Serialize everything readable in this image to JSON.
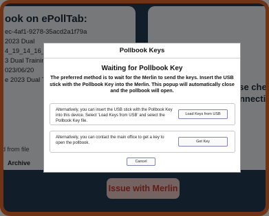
{
  "background": {
    "left_card": {
      "title": "ook on ePollTab:",
      "lines": [
        "ec-4af1-9278-35acd2a1f79a",
        "2023 Dual",
        "4_19_14_16_05",
        "3 Dual Training",
        "023/06/20",
        "e 2023 Dual T"
      ],
      "from_file_label": "d from file",
      "archive_label": "Archive"
    },
    "right_card": {
      "line1": "ase chec",
      "line2": "onnectio"
    },
    "issue_button_label": "Issue with Merlin"
  },
  "modal": {
    "title": "Pollbook Keys",
    "heading": "Waiting for Pollbook Key",
    "description": "The preferred method is to wait for the Merlin to send the keys. Insert the USB stick with the Pollbook Key into the Merlin. This popup will automatically close and the pollbook will open.",
    "option_usb": {
      "text": "Alternatively, you can insert the USB stick with the Pollbook Key into this device. Select 'Load Keys from USB' and select the Pollbook Key file.",
      "button_label": "Load Keys from USB"
    },
    "option_office": {
      "text": "Alternatively, you can contact the main office to get a key to open the pollbook.",
      "button_label": "Get Key"
    },
    "cancel_label": "Cancel"
  },
  "colors": {
    "frame": "#e0672b",
    "screen": "#233d55",
    "issue_text": "#c0392b"
  }
}
